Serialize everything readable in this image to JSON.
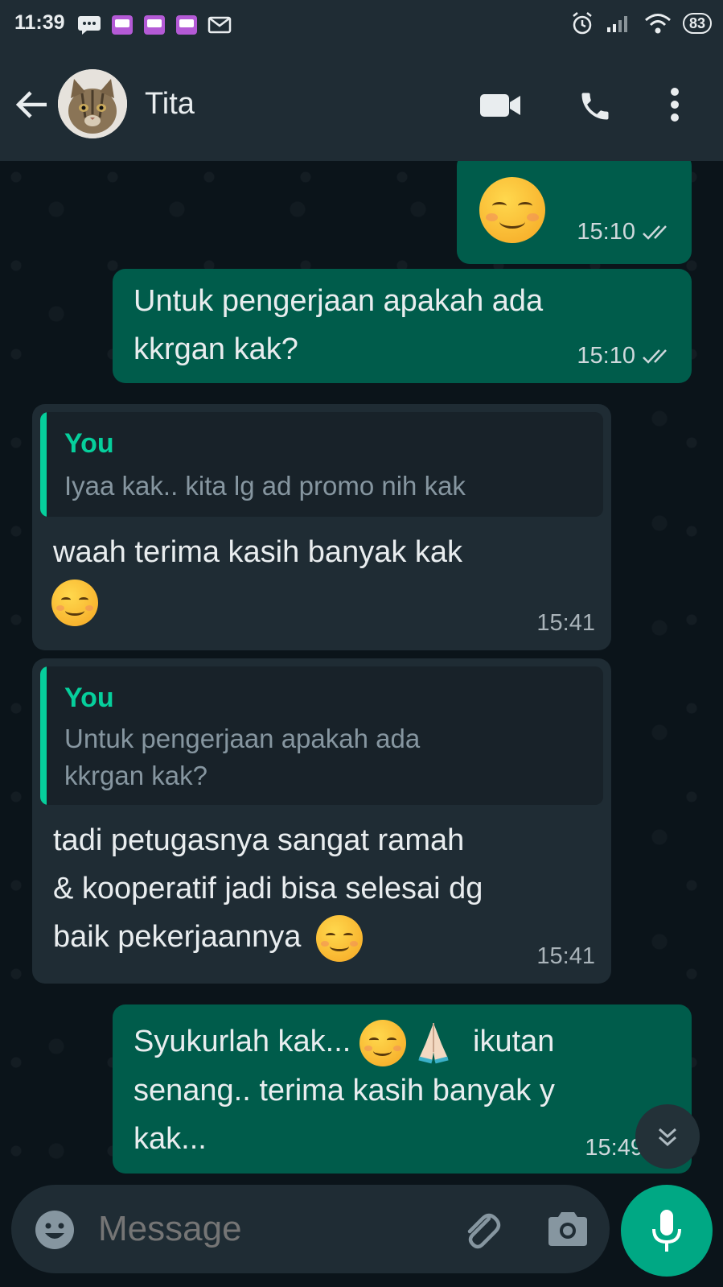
{
  "status_bar": {
    "time": "11:39",
    "battery": "83"
  },
  "header": {
    "contact_name": "Tita"
  },
  "messages": [
    {
      "direction": "outgoing",
      "text": "",
      "time": "15:10",
      "ticks": "read"
    },
    {
      "direction": "outgoing",
      "text_line1": "Untuk pengerjaan apakah ada",
      "text_line2": "kkrgan kak?",
      "time": "15:10",
      "ticks": "read"
    },
    {
      "direction": "incoming",
      "quote_author": "You",
      "quote_text": "Iyaa kak.. kita lg ad promo nih kak",
      "text": "waah terima kasih banyak kak",
      "time": "15:41"
    },
    {
      "direction": "incoming",
      "quote_author": "You",
      "quote_line1": "Untuk pengerjaan apakah ada",
      "quote_line2": "kkrgan kak?",
      "text_line1": "tadi petugasnya sangat ramah",
      "text_line2": "& kooperatif jadi bisa selesai dg",
      "text_line3": "baik pekerjaannya",
      "time": "15:41"
    },
    {
      "direction": "outgoing",
      "text_line1a": "Syukurlah kak...",
      "text_line1b": "ikutan",
      "text_line2": "senang.. terima kasih banyak y",
      "text_line3": "kak...",
      "time": "15:49",
      "ticks": "read"
    }
  ],
  "composer": {
    "placeholder": "Message"
  },
  "colors": {
    "outgoing": "#005c4b",
    "incoming": "#1f2c34",
    "accent": "#00a884",
    "quote_author": "#06cf9c"
  },
  "icons": [
    "back-arrow-icon",
    "video-call-icon",
    "voice-call-icon",
    "more-options-icon",
    "emoji-icon",
    "attach-icon",
    "camera-icon",
    "mic-icon",
    "scroll-down-icon"
  ]
}
